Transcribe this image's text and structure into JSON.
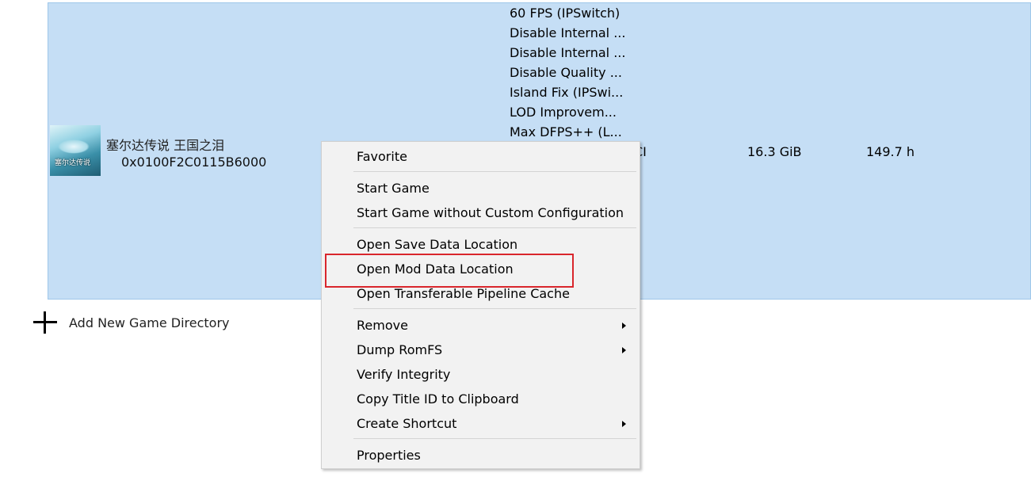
{
  "game": {
    "name": "塞尔达传说 王国之泪",
    "title_id": "0x0100F2C0115B6000",
    "thumbnail_text": "塞尔达传说",
    "file_type": "CI",
    "size": "16.3 GiB",
    "play_time": "149.7 h",
    "addons": [
      "60 FPS (IPSwitch)",
      "Disable Internal ...",
      "Disable Internal ...",
      "Disable Quality ...",
      "Island Fix (IPSwi...",
      "LOD Improvem...",
      "Max DFPS++ (L..."
    ]
  },
  "add_directory": {
    "label": "Add New Game Directory",
    "icon": "plus-icon"
  },
  "context_menu": {
    "favorite": "Favorite",
    "start_game": "Start Game",
    "start_game_no_config": "Start Game without Custom Configuration",
    "open_save_data": "Open Save Data Location",
    "open_mod_data": "Open Mod Data Location",
    "open_pipeline_cache": "Open Transferable Pipeline Cache",
    "remove": "Remove",
    "dump_romfs": "Dump RomFS",
    "verify_integrity": "Verify Integrity",
    "copy_title_id": "Copy Title ID to Clipboard",
    "create_shortcut": "Create Shortcut",
    "properties": "Properties"
  },
  "colors": {
    "row_selected": "#c5def5",
    "menu_background": "#f2f2f2",
    "highlight_border": "#d9262c"
  }
}
